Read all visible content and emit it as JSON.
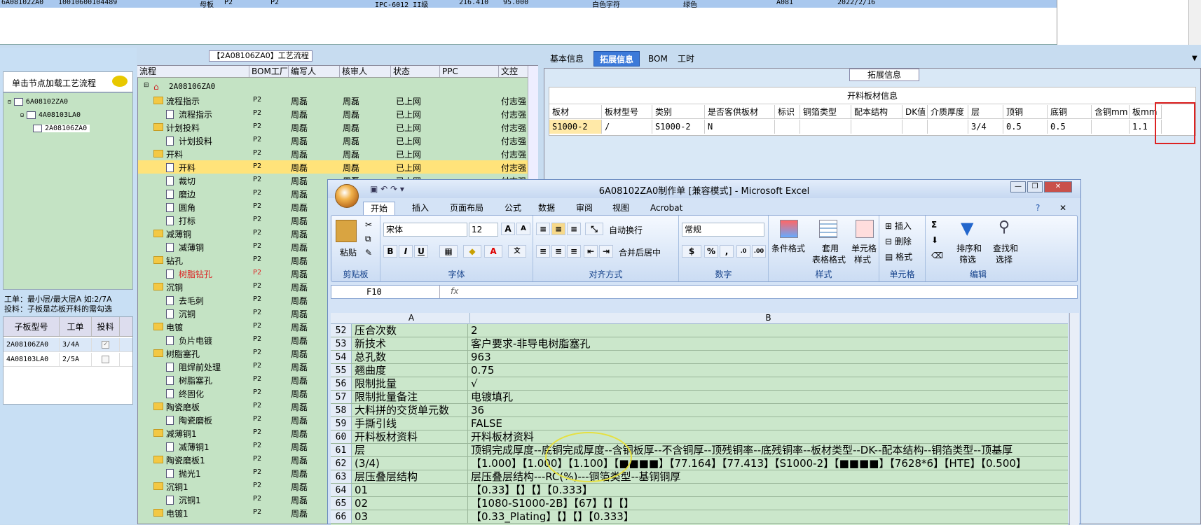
{
  "top_grid": {
    "row": [
      "6A08102ZA0",
      "10010600104489",
      "母板",
      "P2",
      "P2",
      "IPC-6012 II级",
      "216.410",
      "95.000",
      "白色字符",
      "绿色",
      "A081",
      "2022/2/16"
    ]
  },
  "left": {
    "load_hint": "单击节点加载工艺流程",
    "tree": [
      "6A08102ZA0",
      "4A08103LA0",
      "2A08106ZA0"
    ],
    "info_line1": "工单：最小层/最大层A 如:2/7A",
    "info_line2": "投料：子板是芯板开料的需勾选",
    "sub_headers": [
      "子板型号",
      "工单",
      "投料"
    ],
    "sub_rows": [
      {
        "model": "2A08106ZA0",
        "order": "3/4A",
        "checked": "✓"
      },
      {
        "model": "4A08103LA0",
        "order": "2/5A",
        "checked": ""
      }
    ]
  },
  "flow": {
    "title": "【2A08106ZA0】工艺流程",
    "headers": [
      "流程",
      "BOM工厂",
      "编写人",
      "核审人",
      "状态",
      "PPC",
      "文控"
    ],
    "root": "2A08106ZA0",
    "rows": [
      {
        "name": "流程指示",
        "kind": "folder",
        "bom": "P2",
        "writer": "周磊",
        "reviewer": "周磊",
        "status": "已上网",
        "doc": "付志强"
      },
      {
        "name": "流程指示",
        "kind": "doc",
        "bom": "P2",
        "writer": "周磊",
        "reviewer": "周磊",
        "status": "已上网",
        "doc": "付志强"
      },
      {
        "name": "计划投料",
        "kind": "folder",
        "bom": "P2",
        "writer": "周磊",
        "reviewer": "周磊",
        "status": "已上网",
        "doc": "付志强"
      },
      {
        "name": "计划投料",
        "kind": "doc",
        "bom": "P2",
        "writer": "周磊",
        "reviewer": "周磊",
        "status": "已上网",
        "doc": "付志强"
      },
      {
        "name": "开料",
        "kind": "folder",
        "bom": "P2",
        "writer": "周磊",
        "reviewer": "周磊",
        "status": "已上网",
        "doc": "付志强"
      },
      {
        "name": "开料",
        "kind": "doc",
        "bom": "P2",
        "writer": "周磊",
        "reviewer": "周磊",
        "status": "已上网",
        "doc": "付志强"
      },
      {
        "name": "裁切",
        "kind": "doc",
        "bom": "P2",
        "writer": "周磊",
        "reviewer": "周磊",
        "status": "已上网",
        "doc": "付志强"
      },
      {
        "name": "磨边",
        "kind": "doc",
        "bom": "P2",
        "writer": "周磊",
        "reviewer": "",
        "status": "",
        "doc": ""
      },
      {
        "name": "圆角",
        "kind": "doc",
        "bom": "P2",
        "writer": "周磊",
        "reviewer": "",
        "status": "",
        "doc": ""
      },
      {
        "name": "打标",
        "kind": "doc",
        "bom": "P2",
        "writer": "周磊",
        "reviewer": "",
        "status": "",
        "doc": ""
      },
      {
        "name": "减薄铜",
        "kind": "folder",
        "bom": "P2",
        "writer": "周磊",
        "reviewer": "",
        "status": "",
        "doc": ""
      },
      {
        "name": "减薄铜",
        "kind": "doc",
        "bom": "P2",
        "writer": "周磊",
        "reviewer": "",
        "status": "",
        "doc": ""
      },
      {
        "name": "钻孔",
        "kind": "folder",
        "bom": "P2",
        "writer": "周磊",
        "reviewer": "",
        "status": "",
        "doc": ""
      },
      {
        "name": "树脂钻孔",
        "kind": "doc",
        "bom": "P2",
        "writer": "周磊",
        "reviewer": "",
        "status": "",
        "doc": "",
        "red": true
      },
      {
        "name": "沉铜",
        "kind": "folder",
        "bom": "P2",
        "writer": "周磊",
        "reviewer": "",
        "status": "",
        "doc": ""
      },
      {
        "name": "去毛刺",
        "kind": "doc",
        "bom": "P2",
        "writer": "周磊",
        "reviewer": "",
        "status": "",
        "doc": ""
      },
      {
        "name": "沉铜",
        "kind": "doc",
        "bom": "P2",
        "writer": "周磊",
        "reviewer": "",
        "status": "",
        "doc": ""
      },
      {
        "name": "电镀",
        "kind": "folder",
        "bom": "P2",
        "writer": "周磊",
        "reviewer": "",
        "status": "",
        "doc": ""
      },
      {
        "name": "负片电镀",
        "kind": "doc",
        "bom": "P2",
        "writer": "周磊",
        "reviewer": "",
        "status": "",
        "doc": ""
      },
      {
        "name": "树脂塞孔",
        "kind": "folder",
        "bom": "P2",
        "writer": "周磊",
        "reviewer": "",
        "status": "",
        "doc": ""
      },
      {
        "name": "阻焊前处理",
        "kind": "doc",
        "bom": "P2",
        "writer": "周磊",
        "reviewer": "",
        "status": "",
        "doc": ""
      },
      {
        "name": "树脂塞孔",
        "kind": "doc",
        "bom": "P2",
        "writer": "周磊",
        "reviewer": "",
        "status": "",
        "doc": ""
      },
      {
        "name": "终固化",
        "kind": "doc",
        "bom": "P2",
        "writer": "周磊",
        "reviewer": "",
        "status": "",
        "doc": ""
      },
      {
        "name": "陶瓷磨板",
        "kind": "folder",
        "bom": "P2",
        "writer": "周磊",
        "reviewer": "",
        "status": "",
        "doc": ""
      },
      {
        "name": "陶瓷磨板",
        "kind": "doc",
        "bom": "P2",
        "writer": "周磊",
        "reviewer": "",
        "status": "",
        "doc": ""
      },
      {
        "name": "减薄铜1",
        "kind": "folder",
        "bom": "P2",
        "writer": "周磊",
        "reviewer": "",
        "status": "",
        "doc": ""
      },
      {
        "name": "减薄铜1",
        "kind": "doc",
        "bom": "P2",
        "writer": "周磊",
        "reviewer": "",
        "status": "",
        "doc": ""
      },
      {
        "name": "陶瓷磨板1",
        "kind": "folder",
        "bom": "P2",
        "writer": "周磊",
        "reviewer": "",
        "status": "",
        "doc": ""
      },
      {
        "name": "抛光1",
        "kind": "doc",
        "bom": "P2",
        "writer": "周磊",
        "reviewer": "",
        "status": "",
        "doc": ""
      },
      {
        "name": "沉铜1",
        "kind": "folder",
        "bom": "P2",
        "writer": "周磊",
        "reviewer": "",
        "status": "",
        "doc": ""
      },
      {
        "name": "沉铜1",
        "kind": "doc",
        "bom": "P2",
        "writer": "周磊",
        "reviewer": "",
        "status": "",
        "doc": ""
      },
      {
        "name": "电镀1",
        "kind": "folder",
        "bom": "P2",
        "writer": "周磊",
        "reviewer": "",
        "status": "",
        "doc": ""
      }
    ],
    "selected_index": 5
  },
  "right": {
    "tabs": [
      "基本信息",
      "拓展信息",
      "BOM",
      "工时"
    ],
    "active_tab": 1,
    "ext_title": "拓展信息",
    "grid_caption": "开料板材信息",
    "headers": [
      "板材",
      "板材型号",
      "类别",
      "是否客供板材",
      "标识",
      "铜箔类型",
      "配本结构",
      "DK值",
      "介质厚度",
      "层",
      "顶铜",
      "底铜",
      "含铜mm",
      "板mm"
    ],
    "values": [
      "S1000-2",
      "/",
      "S1000-2",
      "N",
      "",
      "",
      "",
      "",
      "",
      "3/4",
      "0.5",
      "0.5",
      "",
      "1.1"
    ]
  },
  "excel": {
    "title": "6A08102ZA0制作单 [兼容模式] - Microsoft Excel",
    "tabs": [
      "开始",
      "插入",
      "页面布局",
      "公式",
      "数据",
      "审阅",
      "视图",
      "Acrobat"
    ],
    "active_tab": 0,
    "font_name": "宋体",
    "font_size": "12",
    "number_format": "常规",
    "groups": {
      "clipboard": "剪贴板",
      "font": "字体",
      "align": "对齐方式",
      "number": "数字",
      "style": "样式",
      "cells": "单元格",
      "edit": "编辑"
    },
    "buttons": {
      "paste": "粘贴",
      "wrap": "自动换行",
      "merge": "合并后居中",
      "cond_format": "条件格式",
      "table_format_1": "套用",
      "table_format_2": "表格格式",
      "cell_style_1": "单元格",
      "cell_style_2": "样式",
      "insert": "插入",
      "delete": "删除",
      "format": "格式",
      "sort_1": "排序和",
      "sort_2": "筛选",
      "find_1": "查找和",
      "find_2": "选择",
      "bold": "B",
      "italic": "I",
      "underline": "U",
      "percent": "%",
      "comma": ","
    },
    "name_box": "F10",
    "fx": "fx",
    "col_a": "A",
    "col_b": "B",
    "rows": [
      {
        "n": "52",
        "a": "压合次数",
        "b": "2"
      },
      {
        "n": "53",
        "a": "新技术",
        "b": "客户要求-非导电树脂塞孔"
      },
      {
        "n": "54",
        "a": "总孔数",
        "b": "963"
      },
      {
        "n": "55",
        "a": "翘曲度",
        "b": "0.75"
      },
      {
        "n": "56",
        "a": "限制批量",
        "b": "√"
      },
      {
        "n": "57",
        "a": "限制批量备注",
        "b": "电镀填孔"
      },
      {
        "n": "58",
        "a": "大料拼的交货单元数",
        "b": "36"
      },
      {
        "n": "59",
        "a": "手撕引线",
        "b": "FALSE"
      },
      {
        "n": "60",
        "a": "开料板材资料",
        "b": "开料板材资料"
      },
      {
        "n": "61",
        "a": "层",
        "b": "顶铜完成厚度--底铜完成厚度--含铜板厚--不含铜厚--顶残铜率--底残铜率--板材类型--DK--配本结构--铜箔类型--顶基厚"
      },
      {
        "n": "62",
        "a": "(3/4)",
        "b": "【1.000】【1.000】【1.100】【■■■■】【77.164】【77.413】【S1000-2】【■■■■】【7628*6】【HTE】【0.500】"
      },
      {
        "n": "63",
        "a": "层压叠层结构",
        "b": "层压叠层结构---RC(%)---铜箔类型--基铜铜厚"
      },
      {
        "n": "64",
        "a": "01",
        "b": "【0.33】【】【】【0.333】"
      },
      {
        "n": "65",
        "a": "02",
        "b": "【1080-S1000-2B】【67】【】【】"
      },
      {
        "n": "66",
        "a": "03",
        "b": "【0.33_Plating】【】【】【0.333】"
      }
    ]
  },
  "colors": {
    "accent": "#3c7ad9",
    "grid_green": "#c4e3c4",
    "selected_row": "#ffe37a",
    "highlight_red": "#dd2222",
    "annotation_yellow": "#e6e040"
  }
}
